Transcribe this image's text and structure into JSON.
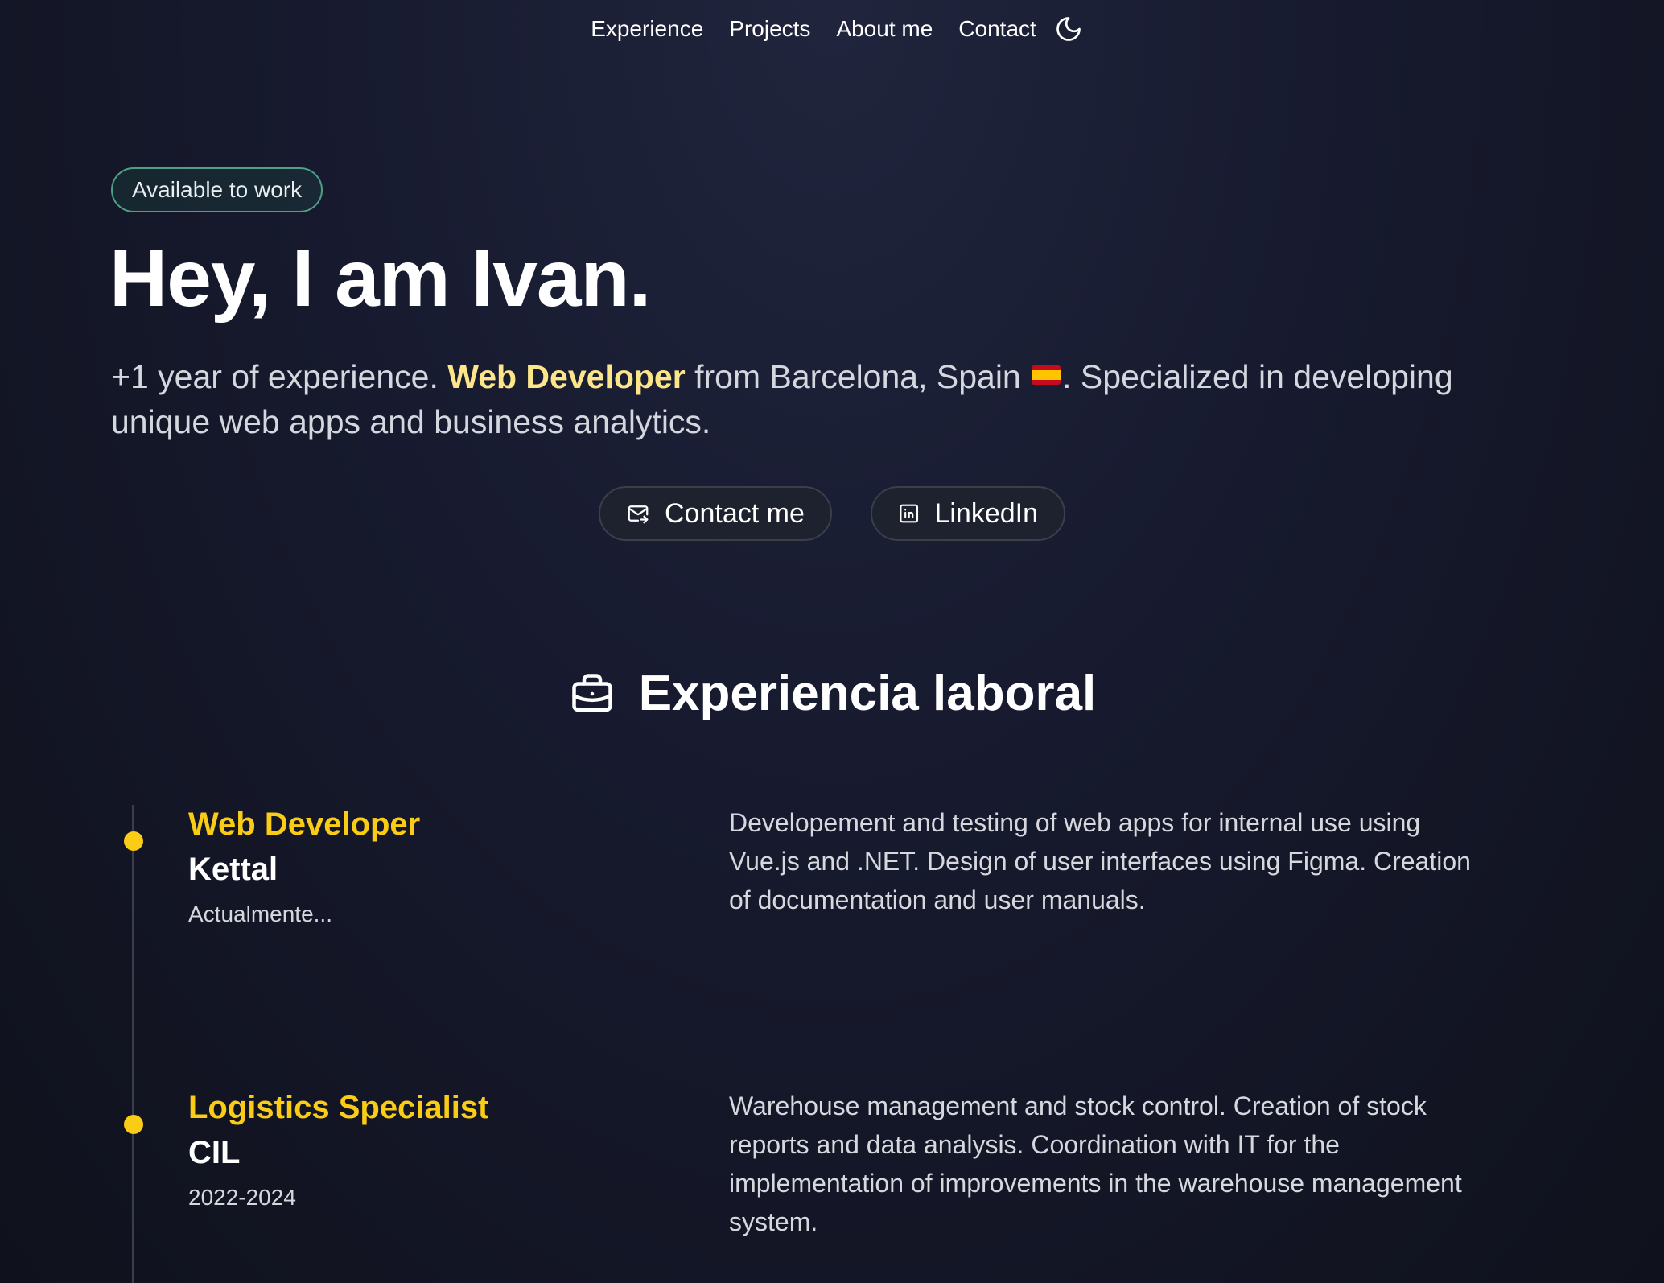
{
  "nav": {
    "items": [
      "Experience",
      "Projects",
      "About me",
      "Contact"
    ],
    "theme_icon": "moon-icon"
  },
  "hero": {
    "badge": "Available to work",
    "title": "Hey, I am Ivan.",
    "desc_before": "+1 year of experience. ",
    "desc_accent": "Web Developer",
    "desc_middle": " from Barcelona, Spain ",
    "desc_after": ". Specialized in developing unique web apps and business analytics.",
    "flag_icon": "spain-flag-icon",
    "accent_color": "#fde68a"
  },
  "buttons": {
    "contact_label": "Contact me",
    "contact_icon": "mail-icon",
    "linkedin_label": "LinkedIn",
    "linkedin_icon": "linkedin-icon"
  },
  "experience": {
    "title": "Experiencia laboral",
    "icon": "briefcase-icon",
    "items": [
      {
        "role": "Web Developer",
        "company": "Kettal",
        "date": "Actualmente...",
        "description": "Developement and testing of web apps for internal use using Vue.js and .NET. Design of user interfaces using Figma. Creation of documentation and user manuals."
      },
      {
        "role": "Logistics Specialist",
        "company": "CIL",
        "date": "2022-2024",
        "description": "Warehouse management and stock control. Creation of stock reports and data analysis. Coordination with IT for the implementation of improvements in the warehouse management system."
      }
    ],
    "dot_color": "#facc15"
  }
}
